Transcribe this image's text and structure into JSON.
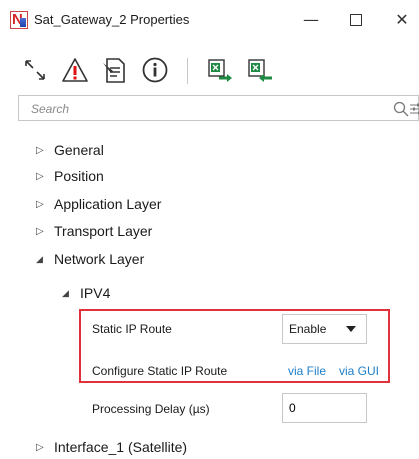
{
  "window": {
    "title": "Sat_Gateway_2 Properties",
    "minimize_glyph": "—",
    "close_glyph": "✕"
  },
  "toolbar": {
    "icons": [
      "expand-collapse-icon",
      "warning-icon",
      "document-icon",
      "info-icon",
      "excel-export-icon",
      "excel-import-icon"
    ]
  },
  "search": {
    "placeholder": "Search"
  },
  "tree": {
    "general": "General",
    "position": "Position",
    "application_layer": "Application Layer",
    "transport_layer": "Transport Layer",
    "network_layer": "Network Layer",
    "ipv4": "IPV4",
    "interface_1": "Interface_1 (Satellite)"
  },
  "ipv4_props": {
    "static_ip_route_label": "Static IP Route",
    "static_ip_route_value": "Enable",
    "configure_label": "Configure Static IP Route",
    "via_file": "via File",
    "via_gui": "via GUI",
    "processing_delay_label": "Processing Delay (µs)",
    "processing_delay_value": "0"
  },
  "colors": {
    "highlight_border": "#e0323a",
    "link": "#1e7ec8"
  }
}
